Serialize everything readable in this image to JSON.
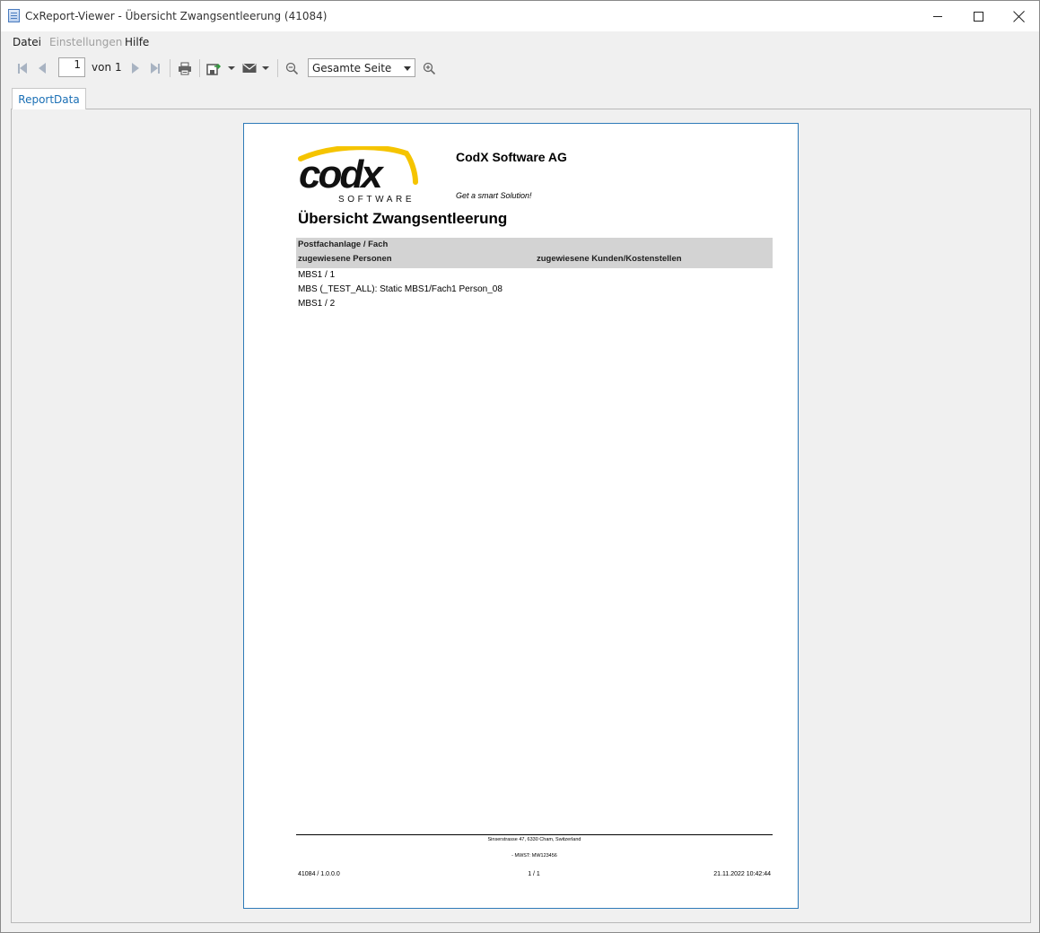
{
  "window": {
    "title": "CxReport-Viewer - Übersicht Zwangsentleerung (41084)"
  },
  "menu": {
    "items": [
      {
        "label": "Datei",
        "enabled": true
      },
      {
        "label": "Einstellungen",
        "enabled": false
      },
      {
        "label": "Hilfe",
        "enabled": true
      }
    ]
  },
  "toolbar": {
    "page_current": "1",
    "page_of_label": "von",
    "page_total": "1",
    "zoom_value": "Gesamte Seite"
  },
  "tabs": [
    {
      "label": "ReportData",
      "active": true
    }
  ],
  "report": {
    "logo_text": "codx",
    "logo_sub": "SOFTWARE",
    "company": "CodX Software AG",
    "slogan": "Get a smart Solution!",
    "title": "Übersicht Zwangsentleerung",
    "header": {
      "col1_line1": "Postfachanlage / Fach",
      "col1_line2": "zugewiesene Personen",
      "col2_line2": "zugewiesene Kunden/Kostenstellen"
    },
    "rows": [
      "MBS1 / 1",
      "MBS (_TEST_ALL): Static MBS1/Fach1 Person_08",
      "MBS1 / 2"
    ],
    "footer": {
      "address": "Sinserstrasse 47,  6330 Cham,  Switzerland",
      "vat": "- MWST: MW123456",
      "left": "41084 / 1.0.0.0",
      "center": "1 / 1",
      "right": "21.11.2022 10:42:44"
    }
  },
  "colors": {
    "accent": "#1a6fb5",
    "page_border": "#2e7ab8",
    "table_header_bg": "#d3d3d3",
    "logo_yellow": "#f5c400"
  }
}
